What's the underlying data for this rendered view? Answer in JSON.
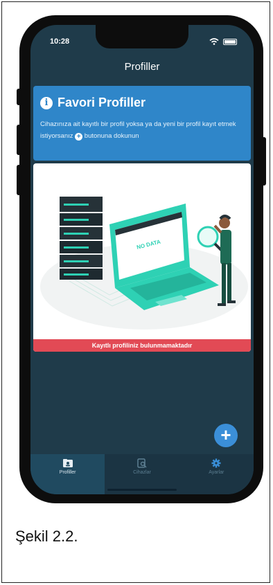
{
  "status_bar": {
    "time": "10:28"
  },
  "header": {
    "title": "Profiller"
  },
  "info_card": {
    "title": "Favori Profiller",
    "text_before": "Cihazınıza ait kayıtlı bir profil yoksa ya da yeni bir profil kayıt etmek istiyorsanız",
    "text_after": "butonuna dokunun"
  },
  "illustration": {
    "screen_text": "NO DATA"
  },
  "empty_state": {
    "message": "Kayıtlı profiliniz bulunmamaktadır"
  },
  "fab": {
    "icon": "plus-icon"
  },
  "tabs": [
    {
      "label": "Profiller",
      "icon": "profile-folder-icon",
      "active": true
    },
    {
      "label": "Cihazlar",
      "icon": "device-search-icon",
      "active": false
    },
    {
      "label": "Ayarlar",
      "icon": "gear-icon",
      "active": false
    }
  ],
  "caption": "Şekil 2.2.",
  "colors": {
    "background": "#1f3b4a",
    "info_card": "#2f86c9",
    "banner": "#e24a55",
    "accent": "#2ed1b4",
    "fab": "#3b8fd8"
  }
}
